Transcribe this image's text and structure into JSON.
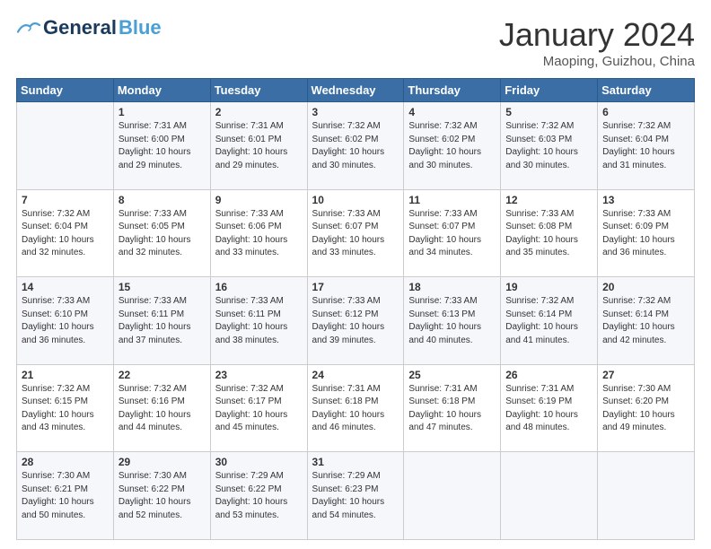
{
  "header": {
    "logo_general": "General",
    "logo_blue": "Blue",
    "month_title": "January 2024",
    "location": "Maoping, Guizhou, China"
  },
  "days_of_week": [
    "Sunday",
    "Monday",
    "Tuesday",
    "Wednesday",
    "Thursday",
    "Friday",
    "Saturday"
  ],
  "weeks": [
    [
      {
        "day": "",
        "info": ""
      },
      {
        "day": "1",
        "info": "Sunrise: 7:31 AM\nSunset: 6:00 PM\nDaylight: 10 hours\nand 29 minutes."
      },
      {
        "day": "2",
        "info": "Sunrise: 7:31 AM\nSunset: 6:01 PM\nDaylight: 10 hours\nand 29 minutes."
      },
      {
        "day": "3",
        "info": "Sunrise: 7:32 AM\nSunset: 6:02 PM\nDaylight: 10 hours\nand 30 minutes."
      },
      {
        "day": "4",
        "info": "Sunrise: 7:32 AM\nSunset: 6:02 PM\nDaylight: 10 hours\nand 30 minutes."
      },
      {
        "day": "5",
        "info": "Sunrise: 7:32 AM\nSunset: 6:03 PM\nDaylight: 10 hours\nand 30 minutes."
      },
      {
        "day": "6",
        "info": "Sunrise: 7:32 AM\nSunset: 6:04 PM\nDaylight: 10 hours\nand 31 minutes."
      }
    ],
    [
      {
        "day": "7",
        "info": "Sunrise: 7:32 AM\nSunset: 6:04 PM\nDaylight: 10 hours\nand 32 minutes."
      },
      {
        "day": "8",
        "info": "Sunrise: 7:33 AM\nSunset: 6:05 PM\nDaylight: 10 hours\nand 32 minutes."
      },
      {
        "day": "9",
        "info": "Sunrise: 7:33 AM\nSunset: 6:06 PM\nDaylight: 10 hours\nand 33 minutes."
      },
      {
        "day": "10",
        "info": "Sunrise: 7:33 AM\nSunset: 6:07 PM\nDaylight: 10 hours\nand 33 minutes."
      },
      {
        "day": "11",
        "info": "Sunrise: 7:33 AM\nSunset: 6:07 PM\nDaylight: 10 hours\nand 34 minutes."
      },
      {
        "day": "12",
        "info": "Sunrise: 7:33 AM\nSunset: 6:08 PM\nDaylight: 10 hours\nand 35 minutes."
      },
      {
        "day": "13",
        "info": "Sunrise: 7:33 AM\nSunset: 6:09 PM\nDaylight: 10 hours\nand 36 minutes."
      }
    ],
    [
      {
        "day": "14",
        "info": "Sunrise: 7:33 AM\nSunset: 6:10 PM\nDaylight: 10 hours\nand 36 minutes."
      },
      {
        "day": "15",
        "info": "Sunrise: 7:33 AM\nSunset: 6:11 PM\nDaylight: 10 hours\nand 37 minutes."
      },
      {
        "day": "16",
        "info": "Sunrise: 7:33 AM\nSunset: 6:11 PM\nDaylight: 10 hours\nand 38 minutes."
      },
      {
        "day": "17",
        "info": "Sunrise: 7:33 AM\nSunset: 6:12 PM\nDaylight: 10 hours\nand 39 minutes."
      },
      {
        "day": "18",
        "info": "Sunrise: 7:33 AM\nSunset: 6:13 PM\nDaylight: 10 hours\nand 40 minutes."
      },
      {
        "day": "19",
        "info": "Sunrise: 7:32 AM\nSunset: 6:14 PM\nDaylight: 10 hours\nand 41 minutes."
      },
      {
        "day": "20",
        "info": "Sunrise: 7:32 AM\nSunset: 6:14 PM\nDaylight: 10 hours\nand 42 minutes."
      }
    ],
    [
      {
        "day": "21",
        "info": "Sunrise: 7:32 AM\nSunset: 6:15 PM\nDaylight: 10 hours\nand 43 minutes."
      },
      {
        "day": "22",
        "info": "Sunrise: 7:32 AM\nSunset: 6:16 PM\nDaylight: 10 hours\nand 44 minutes."
      },
      {
        "day": "23",
        "info": "Sunrise: 7:32 AM\nSunset: 6:17 PM\nDaylight: 10 hours\nand 45 minutes."
      },
      {
        "day": "24",
        "info": "Sunrise: 7:31 AM\nSunset: 6:18 PM\nDaylight: 10 hours\nand 46 minutes."
      },
      {
        "day": "25",
        "info": "Sunrise: 7:31 AM\nSunset: 6:18 PM\nDaylight: 10 hours\nand 47 minutes."
      },
      {
        "day": "26",
        "info": "Sunrise: 7:31 AM\nSunset: 6:19 PM\nDaylight: 10 hours\nand 48 minutes."
      },
      {
        "day": "27",
        "info": "Sunrise: 7:30 AM\nSunset: 6:20 PM\nDaylight: 10 hours\nand 49 minutes."
      }
    ],
    [
      {
        "day": "28",
        "info": "Sunrise: 7:30 AM\nSunset: 6:21 PM\nDaylight: 10 hours\nand 50 minutes."
      },
      {
        "day": "29",
        "info": "Sunrise: 7:30 AM\nSunset: 6:22 PM\nDaylight: 10 hours\nand 52 minutes."
      },
      {
        "day": "30",
        "info": "Sunrise: 7:29 AM\nSunset: 6:22 PM\nDaylight: 10 hours\nand 53 minutes."
      },
      {
        "day": "31",
        "info": "Sunrise: 7:29 AM\nSunset: 6:23 PM\nDaylight: 10 hours\nand 54 minutes."
      },
      {
        "day": "",
        "info": ""
      },
      {
        "day": "",
        "info": ""
      },
      {
        "day": "",
        "info": ""
      }
    ]
  ]
}
